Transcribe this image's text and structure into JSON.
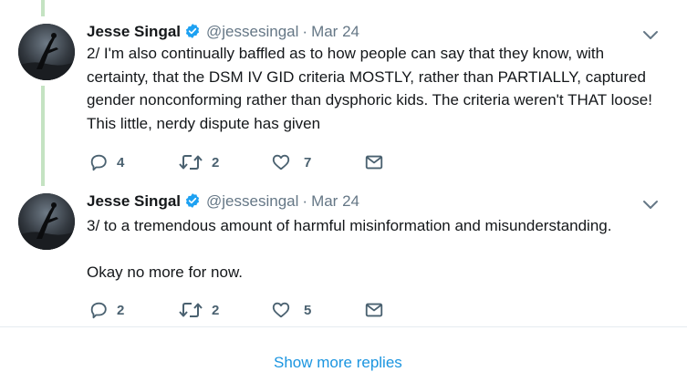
{
  "tweets": [
    {
      "author_name": "Jesse Singal",
      "author_handle": "@jessesingal",
      "separator": "·",
      "date": "Mar 24",
      "text": "2/ I'm also continually baffled as to how people can say that they know, with certainty, that the DSM IV GID criteria MOSTLY, rather than PARTIALLY, captured gender nonconforming rather than dysphoric kids. The criteria weren't THAT loose! This little, nerdy dispute has given",
      "reply_count": "4",
      "retweet_count": "2",
      "like_count": "7"
    },
    {
      "author_name": "Jesse Singal",
      "author_handle": "@jessesingal",
      "separator": "·",
      "date": "Mar 24",
      "text": "3/ to a tremendous amount of harmful misinformation and misunderstanding.\n\nOkay no more for now.",
      "reply_count": "2",
      "retweet_count": "2",
      "like_count": "5"
    }
  ],
  "show_more_label": "Show more replies",
  "colors": {
    "thread_line": "#c4e3c2",
    "verified": "#1da1f2",
    "link": "#1b95e0",
    "muted": "#657786",
    "action_icon": "#4a6170"
  },
  "icons": [
    "verified-badge-icon",
    "chevron-down-icon",
    "reply-icon",
    "retweet-icon",
    "like-icon",
    "direct-message-icon"
  ]
}
